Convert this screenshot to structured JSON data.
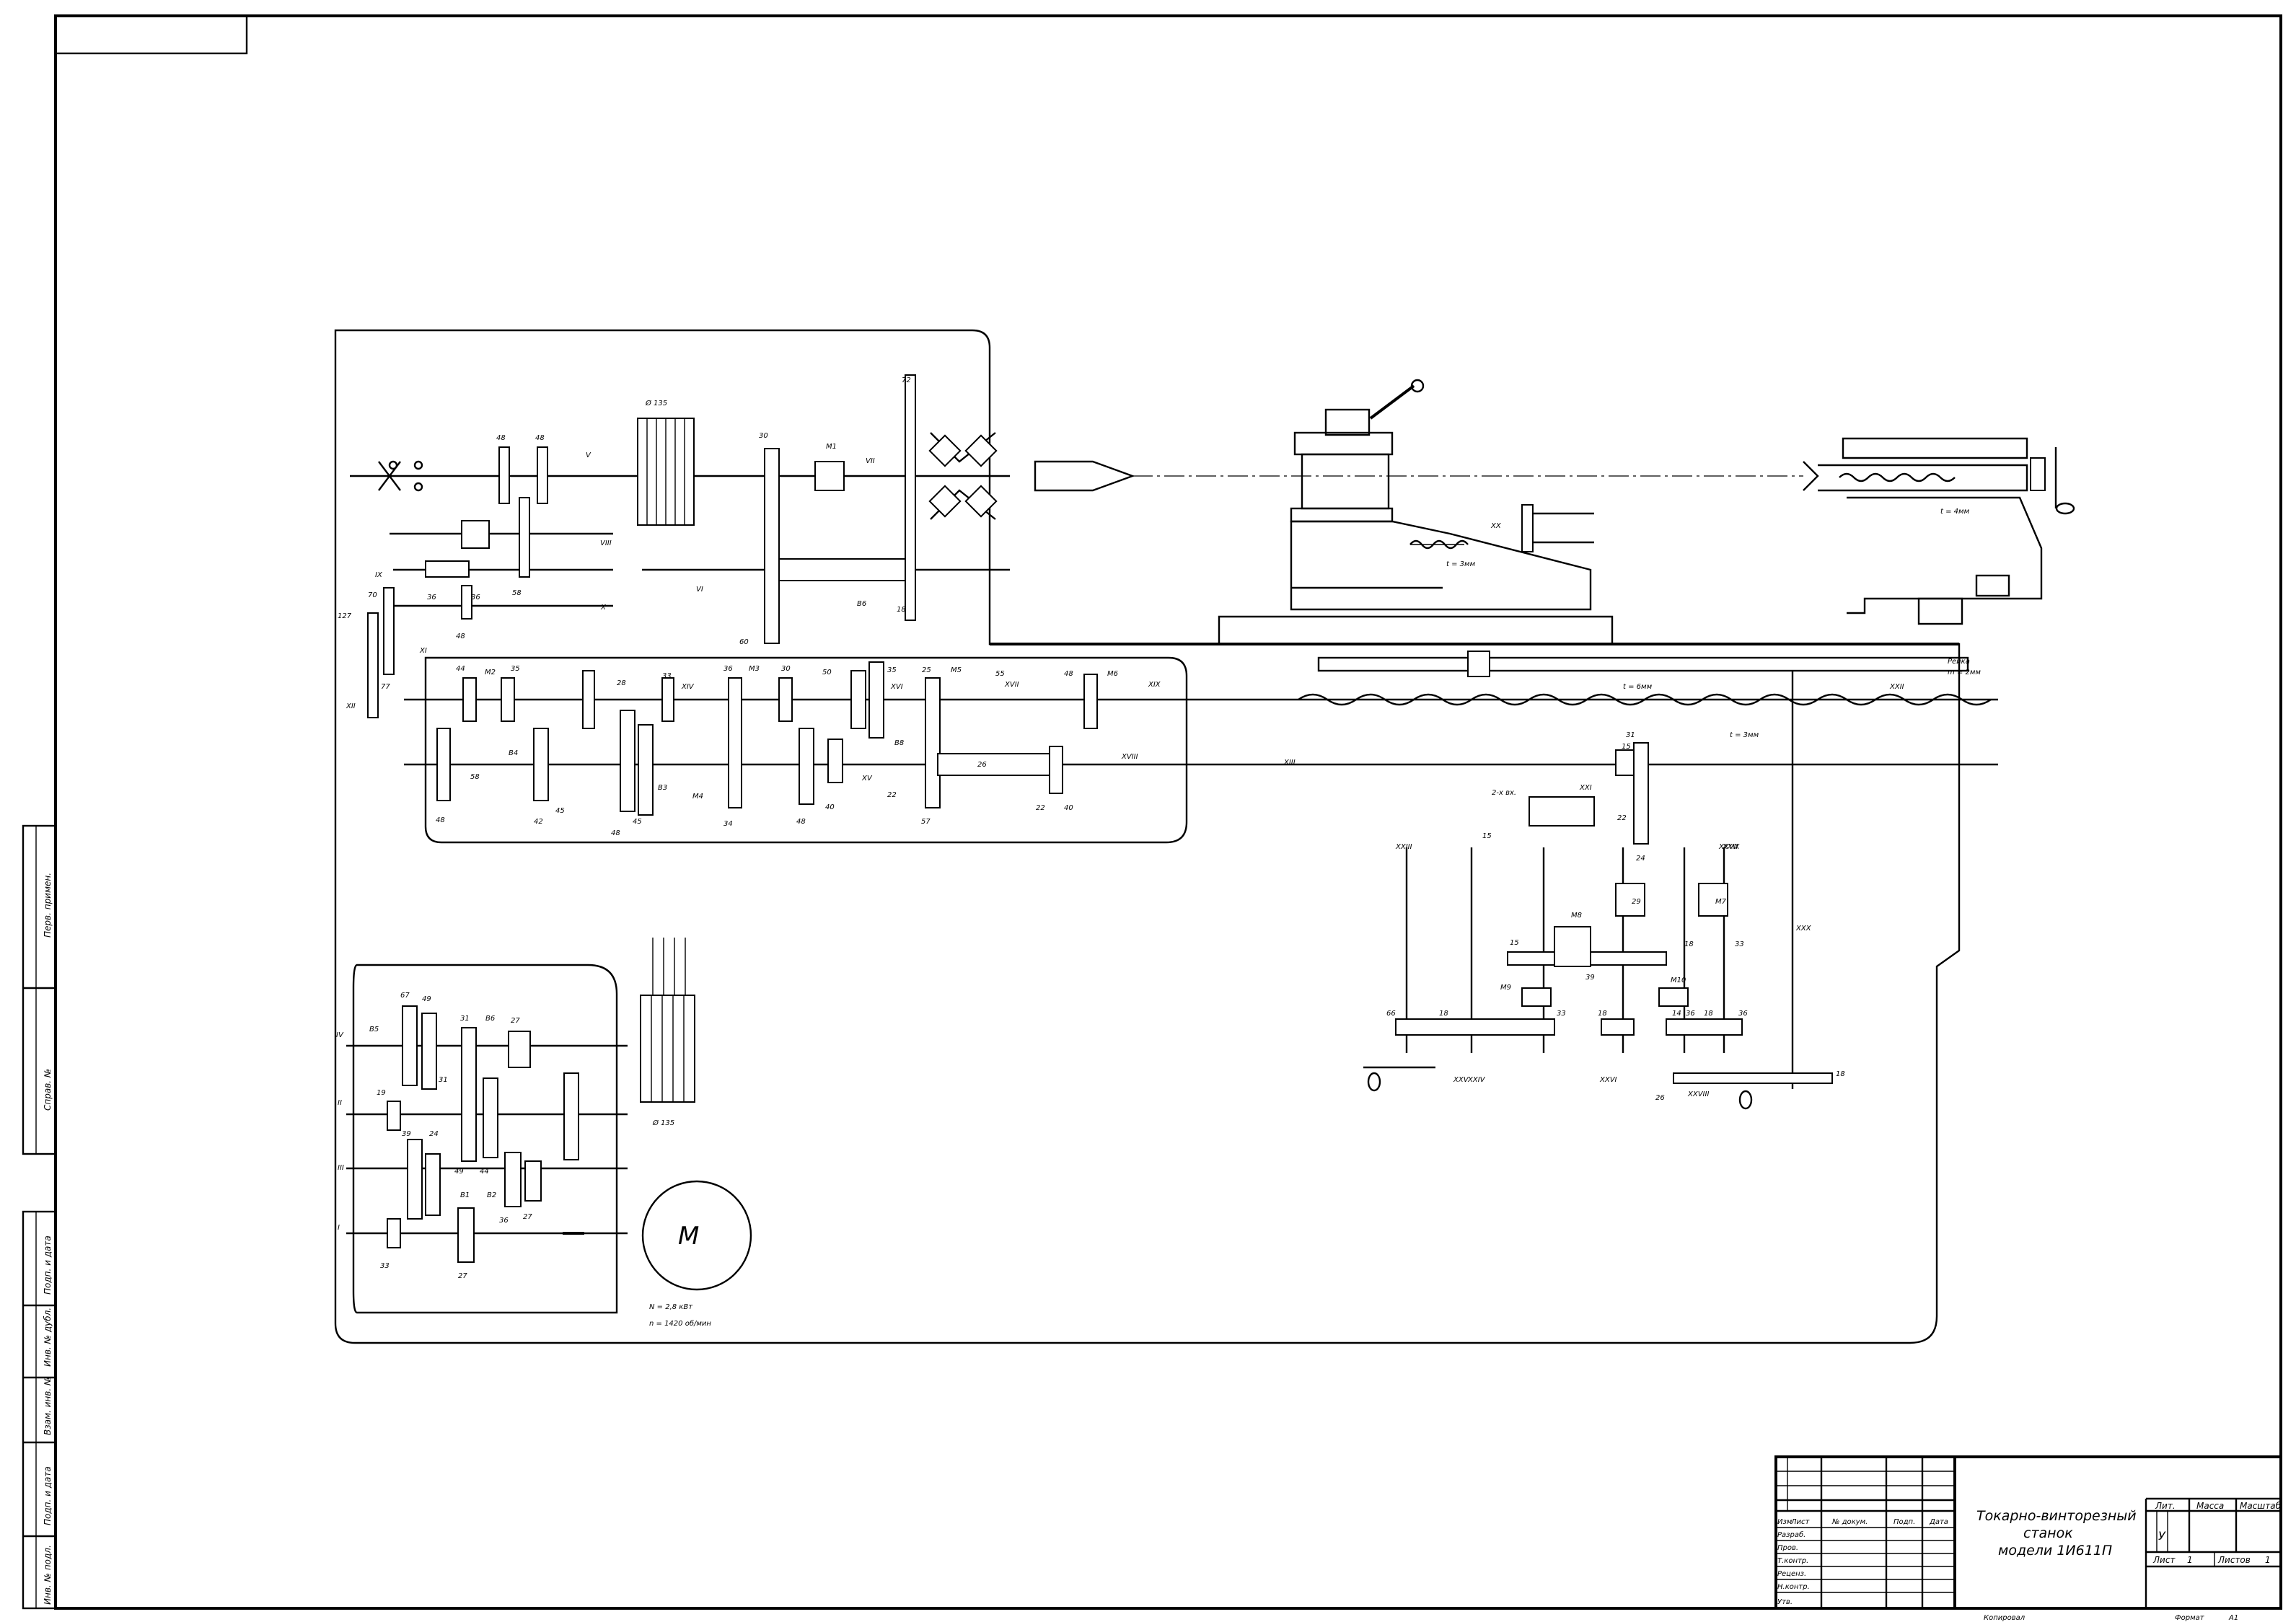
{
  "title_block": {
    "title_line1": "Токарно-винторезный",
    "title_line2": "станок",
    "title_line3": "модели 1И611П",
    "lit_header": "Лит.",
    "mass_header": "Масса",
    "scale_header": "Масштаб",
    "lit_value": "У",
    "sheet_label": "Лист",
    "sheet_number": "1",
    "sheets_label": "Листов",
    "sheets_number": "1",
    "col_izm": "Изм",
    "col_list": "Лист",
    "col_doc": "№ докум.",
    "col_sign": "Подп.",
    "col_date": "Дата",
    "role_1": "Разраб.",
    "role_2": "Пров.",
    "role_3": "Т.контр.",
    "role_4": "Реценз.",
    "role_5": "Н.контр.",
    "role_6": "Утв.",
    "copied": "Копировал",
    "format_label": "Формат",
    "format_value": "А1"
  },
  "side_stamp": {
    "perv_primen": "Перв. примен.",
    "sprav": "Справ. №",
    "podp_data_1": "Подп. и дата",
    "inv_dubl": "Инв. № дубл.",
    "vzam_inv": "Взам. инв. №",
    "podp_data_2": "Подп. и дата",
    "inv_podl": "Инв. № подл."
  },
  "motor": {
    "symbol": "M",
    "power": "N = 2,8 кВт",
    "speed": "n = 1420 об/мин",
    "pulley_1": "Ø 135",
    "pulley_2": "Ø 135"
  },
  "pitch_labels": {
    "tailstock_screw": "t = 4мм",
    "cross_screw": "t = 3мм",
    "lead_screw": "t = 6мм",
    "apron_screw": "t = 3мм",
    "rack": "Рейка",
    "rack_module": "m = 2мм",
    "clutch_24": "2-х вх."
  },
  "shaft_labels": [
    "I",
    "II",
    "III",
    "IV",
    "V",
    "VI",
    "VII",
    "VIII",
    "IX",
    "X",
    "XI",
    "XII",
    "XIII",
    "XIV",
    "XV",
    "XVI",
    "XVII",
    "XVIII",
    "XIX",
    "XX",
    "XXI",
    "XXII",
    "XXIII",
    "XXIV",
    "XXV",
    "XXVI",
    "XXVII",
    "XXVIII",
    "XXIX",
    "XXX"
  ],
  "gear_labels": [
    "48",
    "48",
    "30",
    "72",
    "M1",
    "60",
    "B6",
    "18",
    "36",
    "36",
    "48",
    "58",
    "127",
    "70",
    "77",
    "44",
    "35",
    "M2",
    "28",
    "33",
    "36",
    "M3",
    "30",
    "50",
    "35",
    "M5",
    "25",
    "55",
    "48",
    "M6",
    "48",
    "58",
    "B4",
    "45",
    "42",
    "48",
    "45",
    "B3",
    "M4",
    "34",
    "48",
    "40",
    "22",
    "B8",
    "57",
    "26",
    "22",
    "40",
    "67",
    "49",
    "B5",
    "31",
    "B6",
    "27",
    "19",
    "31",
    "39",
    "24",
    "49",
    "44",
    "B1",
    "B2",
    "27",
    "36",
    "33",
    "27",
    "31",
    "15",
    "22",
    "15",
    "24",
    "29",
    "M7",
    "M8",
    "15",
    "39",
    "M9",
    "M10",
    "18",
    "33",
    "33",
    "14",
    "66",
    "18",
    "18",
    "36",
    "18",
    "36",
    "26",
    "18",
    "15"
  ],
  "colors": {
    "line": "#000000",
    "paper": "#ffffff"
  }
}
